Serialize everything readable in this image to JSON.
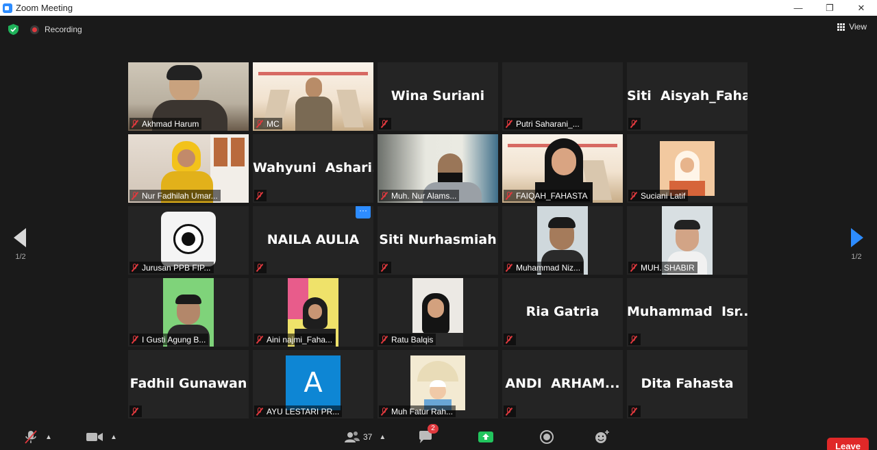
{
  "window": {
    "title": "Zoom Meeting",
    "minimize": "—",
    "restore": "❐",
    "close": "✕"
  },
  "topbar": {
    "recording_label": "Recording",
    "view_label": "View"
  },
  "pager": {
    "left_label": "1/2",
    "right_label": "1/2"
  },
  "participants": [
    {
      "name": "Akhmad Harum",
      "video": true,
      "active": false
    },
    {
      "name": "MC",
      "video": true,
      "active": false
    },
    {
      "name": "Wina Suriani",
      "video": false,
      "active": false
    },
    {
      "name": "Putri Saharani_...",
      "video": true,
      "active": false
    },
    {
      "name": "Siti  Aisyah_Faha...",
      "video": false,
      "active": false
    },
    {
      "name": "Nur Fadhilah Umar...",
      "video": true,
      "active": true
    },
    {
      "name": "Wahyuni  Ashari...",
      "video": false,
      "active": false
    },
    {
      "name": "Muh. Nur Alams...",
      "video": true,
      "active": false
    },
    {
      "name": "FAIQAH_FAHASTA",
      "video": true,
      "active": false
    },
    {
      "name": "Suciani Latif",
      "video": true,
      "active": false
    },
    {
      "name": "Jurusan PPB FIP...",
      "video": true,
      "active": false
    },
    {
      "name": "NAILA AULIA",
      "video": false,
      "active": false
    },
    {
      "name": "Siti Nurhasmiah",
      "video": false,
      "active": false
    },
    {
      "name": "Muhammad Niz...",
      "video": true,
      "active": false
    },
    {
      "name": "MUH. SHABIR",
      "video": true,
      "active": false
    },
    {
      "name": "I Gusti Agung B...",
      "video": true,
      "active": false
    },
    {
      "name": "Aini najmi_Faha...",
      "video": true,
      "active": false
    },
    {
      "name": "Ratu Balqis",
      "video": true,
      "active": false
    },
    {
      "name": "Ria Gatria",
      "video": false,
      "active": false
    },
    {
      "name": "Muhammad  Isr...",
      "video": false,
      "active": false
    },
    {
      "name": "Fadhil Gunawan",
      "video": false,
      "active": false
    },
    {
      "name": "AYU LESTARI PR...",
      "video": true,
      "active": false
    },
    {
      "name": "Muh Fatur Rah...",
      "video": true,
      "active": false
    },
    {
      "name": "ANDI  ARHAM...",
      "video": false,
      "active": false
    },
    {
      "name": "Dita Fahasta",
      "video": false,
      "active": false
    }
  ],
  "tile_extras": {
    "naila_more": "···",
    "ayu_avatar_letter": "A"
  },
  "toolbar": {
    "participants_count": "37",
    "chat_badge": "2",
    "leave_label": "Leave"
  },
  "colors": {
    "zoom_blue": "#2d8cff",
    "active_speaker": "#e8f06e",
    "mute_red": "#e0393e",
    "leave_red": "#e02828",
    "share_green": "#22c55e"
  }
}
